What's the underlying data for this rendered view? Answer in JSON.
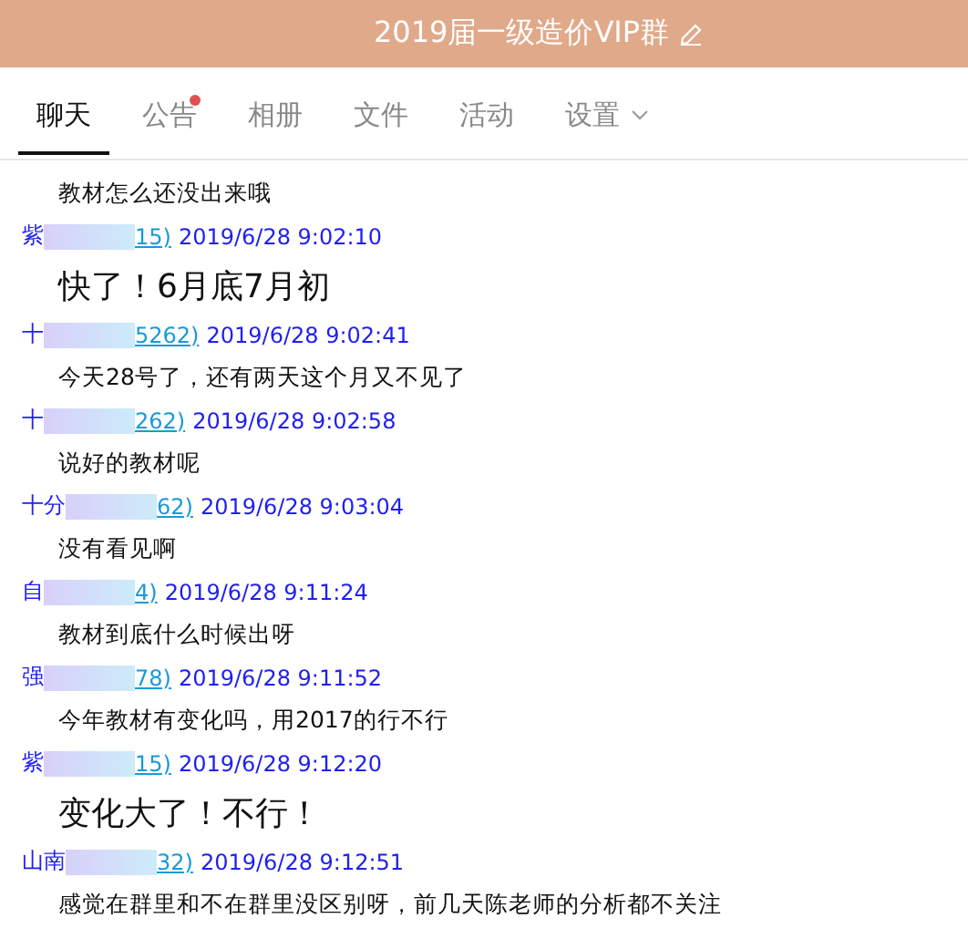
{
  "header": {
    "title": "2019届一级造价VIP群"
  },
  "tabs": [
    {
      "label": "聊天",
      "selected": true,
      "badge": false,
      "dropdown": false
    },
    {
      "label": "公告",
      "selected": false,
      "badge": true,
      "dropdown": false
    },
    {
      "label": "相册",
      "selected": false,
      "badge": false,
      "dropdown": false
    },
    {
      "label": "文件",
      "selected": false,
      "badge": false,
      "dropdown": false
    },
    {
      "label": "活动",
      "selected": false,
      "badge": false,
      "dropdown": false
    },
    {
      "label": "设置",
      "selected": false,
      "badge": false,
      "dropdown": true
    }
  ],
  "messages": [
    {
      "kind": "text",
      "text": "教材怎么还没出来哦"
    },
    {
      "kind": "sender",
      "name": "紫",
      "id_tail": "15)",
      "time": "2019/6/28 9:02:10"
    },
    {
      "kind": "large",
      "text": "快了！6月底7月初"
    },
    {
      "kind": "sender",
      "name": "十",
      "id_tail": "5262)",
      "time": "2019/6/28 9:02:41"
    },
    {
      "kind": "text",
      "text": "今天28号了，还有两天这个月又不见了"
    },
    {
      "kind": "sender",
      "name": "十",
      "id_tail": "262)",
      "time": "2019/6/28 9:02:58"
    },
    {
      "kind": "text",
      "text": "说好的教材呢"
    },
    {
      "kind": "sender",
      "name": "十分",
      "id_tail": "62)",
      "time": "2019/6/28 9:03:04"
    },
    {
      "kind": "text",
      "text": "没有看见啊"
    },
    {
      "kind": "sender",
      "name": "自",
      "id_tail": "4)",
      "time": "2019/6/28 9:11:24"
    },
    {
      "kind": "text",
      "text": "教材到底什么时候出呀"
    },
    {
      "kind": "sender",
      "name": "强",
      "id_tail": "78)",
      "time": "2019/6/28 9:11:52"
    },
    {
      "kind": "text",
      "text": "今年教材有变化吗，用2017的行不行"
    },
    {
      "kind": "sender",
      "name": "紫",
      "id_tail": "15)",
      "time": "2019/6/28 9:12:20"
    },
    {
      "kind": "large",
      "text": "变化大了！不行！"
    },
    {
      "kind": "sender",
      "name": "山南",
      "id_tail": "32)",
      "time": "2019/6/28 9:12:51"
    },
    {
      "kind": "text",
      "text": "感觉在群里和不在群里没区别呀，前几天陈老师的分析都不关注"
    }
  ]
}
